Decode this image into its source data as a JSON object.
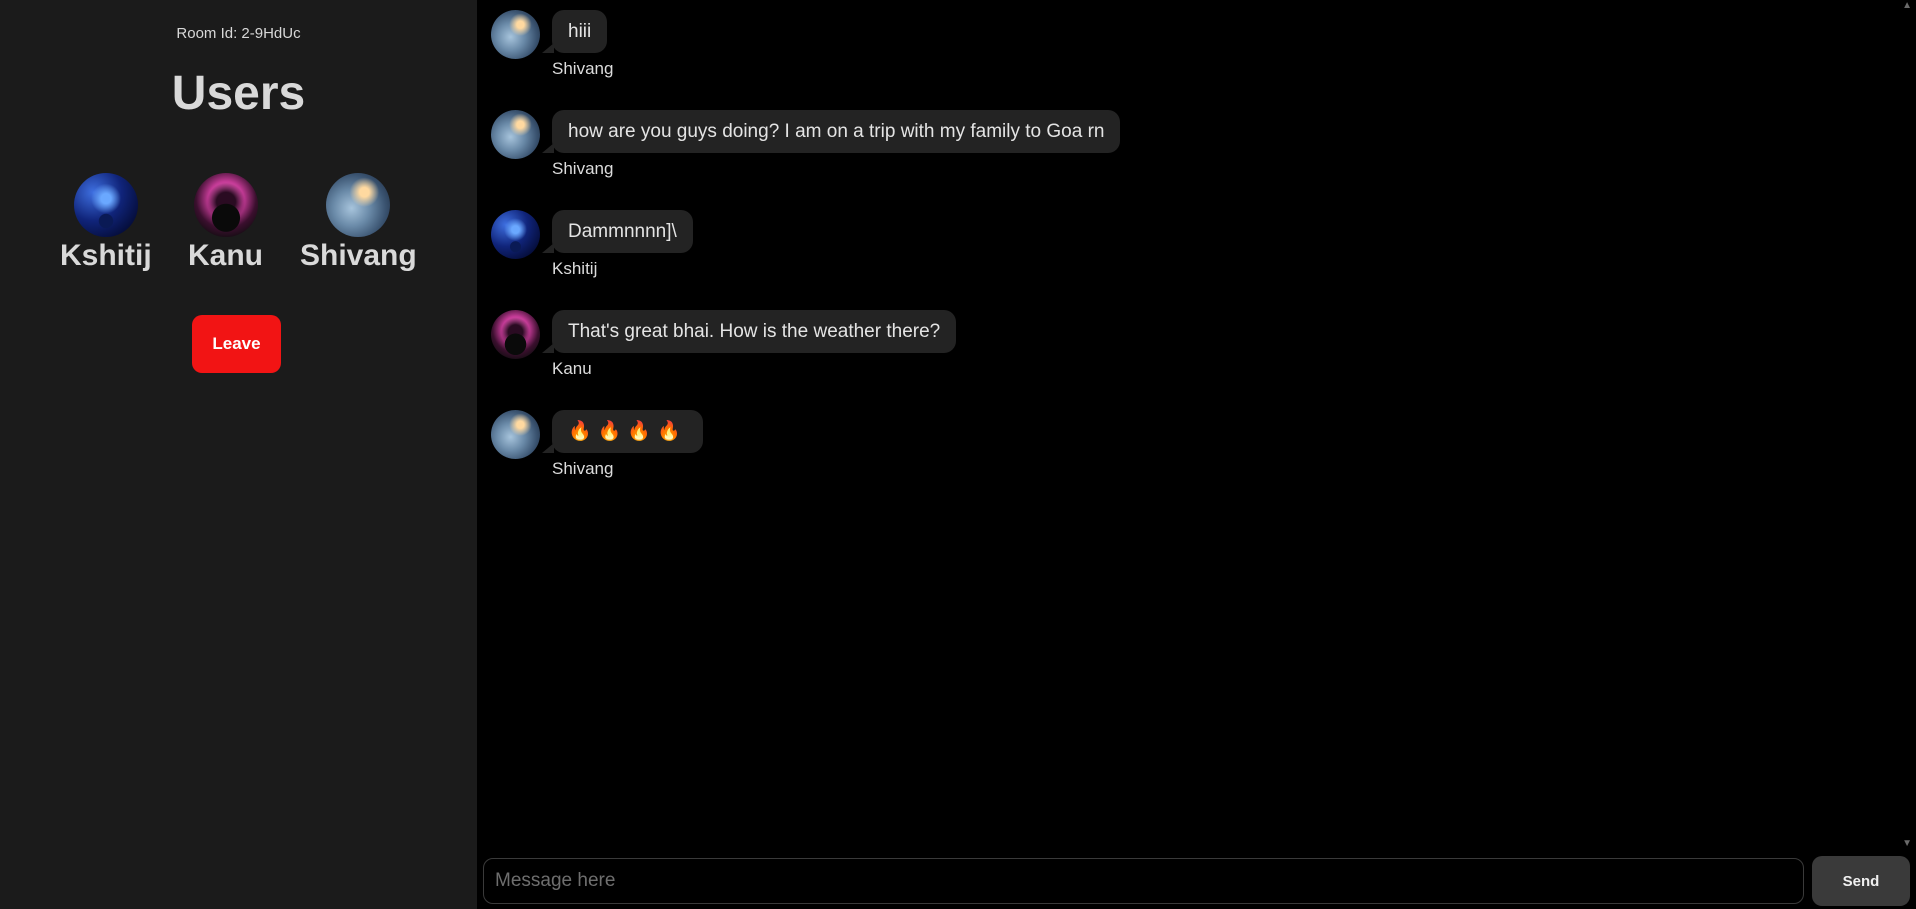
{
  "sidebar": {
    "room_id": "Room Id: 2-9HdUc",
    "title": "Users",
    "users": [
      {
        "name": "Kshitij",
        "avatar": "kshitij-avatar"
      },
      {
        "name": "Kanu",
        "avatar": "kanu-avatar"
      },
      {
        "name": "Shivang",
        "avatar": "shivang-avatar"
      }
    ],
    "leave_label": "Leave",
    "leave_color": "#f21414"
  },
  "chat": {
    "messages": [
      {
        "sender": "Shivang",
        "text": "hiii"
      },
      {
        "sender": "Shivang",
        "text": "how are you guys doing? I am on a trip with my family to Goa rn"
      },
      {
        "sender": "Kshitij",
        "text": "Dammnnnn]\\"
      },
      {
        "sender": "Kanu",
        "text": "That's great bhai. How is the weather there?"
      },
      {
        "sender": "Shivang",
        "text": "🔥🔥🔥🔥"
      }
    ],
    "input_placeholder": "Message here",
    "send_label": "Send"
  },
  "colors": {
    "sidebar_bg": "#1b1b1b",
    "chat_bg": "#000000",
    "bubble_bg": "#232323",
    "send_bg": "#3a3a3a"
  }
}
